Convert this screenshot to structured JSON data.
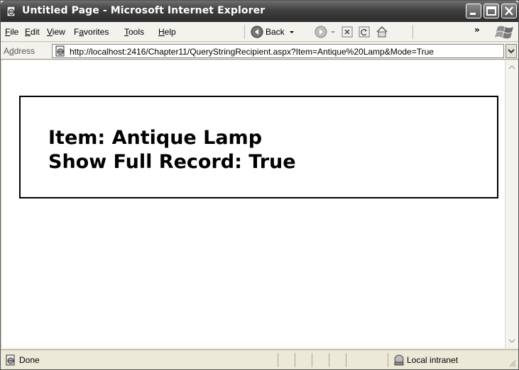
{
  "window": {
    "title": "Untitled Page - Microsoft Internet Explorer"
  },
  "menu": {
    "items": [
      {
        "label": "File",
        "mnemonic": "F",
        "rest": "ile"
      },
      {
        "label": "Edit",
        "mnemonic": "E",
        "rest": "dit"
      },
      {
        "label": "View",
        "mnemonic": "V",
        "rest": "iew"
      },
      {
        "label": "Favorites",
        "pre": "F",
        "mnemonic": "a",
        "rest": "vorites"
      },
      {
        "label": "Tools",
        "mnemonic": "T",
        "rest": "ools"
      },
      {
        "label": "Help",
        "mnemonic": "H",
        "rest": "elp"
      }
    ]
  },
  "toolbar": {
    "back_label": "Back",
    "overflow": "»"
  },
  "address": {
    "label": "Address",
    "label_pre": "A",
    "label_mnemonic": "d",
    "label_rest": "dress",
    "url": "http://localhost:2416/Chapter11/QueryStringRecipient.aspx?Item=Antique%20Lamp&Mode=True"
  },
  "page": {
    "line1": "Item: Antique Lamp",
    "line2": "Show Full Record: True"
  },
  "status": {
    "text": "Done",
    "zone": "Local intranet"
  },
  "icons": {
    "app": "ie-page-icon",
    "back": "back-arrow-icon",
    "forward": "forward-arrow-icon",
    "stop": "stop-icon",
    "refresh": "refresh-icon",
    "home": "home-icon",
    "windows_logo": "windows-logo-icon"
  }
}
